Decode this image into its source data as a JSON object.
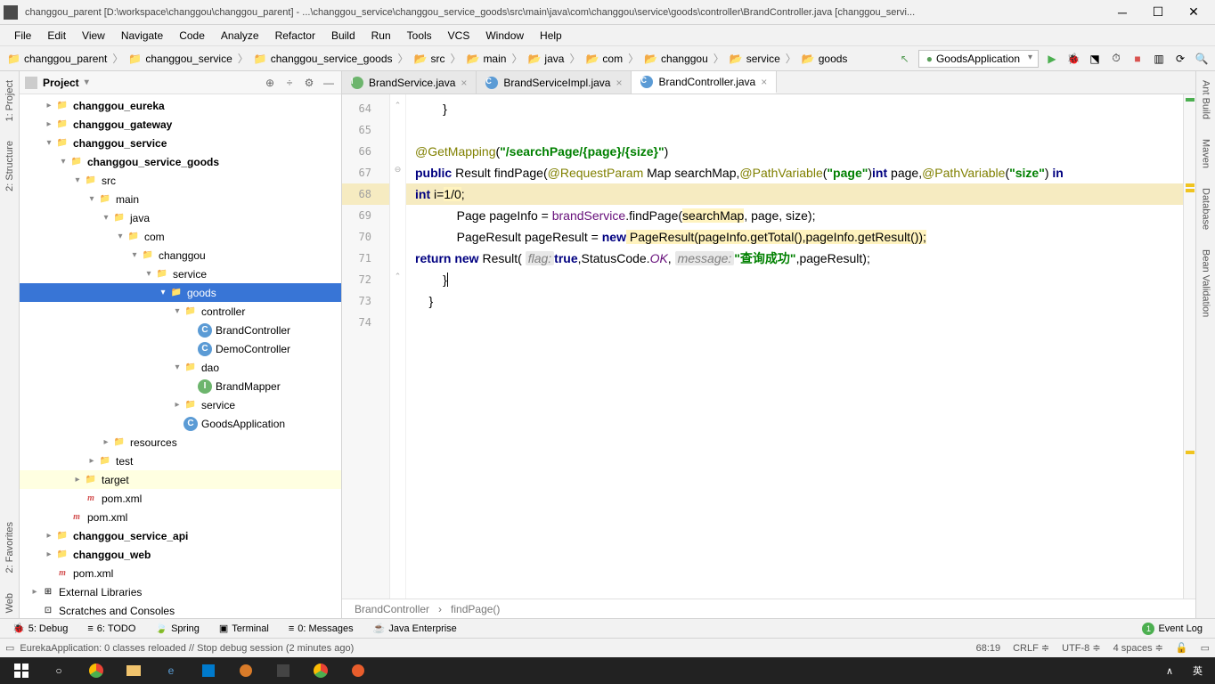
{
  "window": {
    "title": "changgou_parent [D:\\workspace\\changgou\\changgou_parent] - ...\\changgou_service\\changgou_service_goods\\src\\main\\java\\com\\changgou\\service\\goods\\controller\\BrandController.java [changgou_servi..."
  },
  "menubar": [
    "File",
    "Edit",
    "View",
    "Navigate",
    "Code",
    "Analyze",
    "Refactor",
    "Build",
    "Run",
    "Tools",
    "VCS",
    "Window",
    "Help"
  ],
  "breadcrumbs": [
    "changgou_parent",
    "changgou_service",
    "changgou_service_goods",
    "src",
    "main",
    "java",
    "com",
    "changgou",
    "service",
    "goods"
  ],
  "run_config": "GoodsApplication",
  "project_panel": {
    "title": "Project"
  },
  "tree": [
    {
      "d": 1,
      "a": "right",
      "icon": "folder",
      "label": "changgou_eureka",
      "bold": true
    },
    {
      "d": 1,
      "a": "right",
      "icon": "folder",
      "label": "changgou_gateway",
      "bold": true
    },
    {
      "d": 1,
      "a": "down",
      "icon": "folder",
      "label": "changgou_service",
      "bold": true
    },
    {
      "d": 2,
      "a": "down",
      "icon": "folder",
      "label": "changgou_service_goods",
      "bold": true
    },
    {
      "d": 3,
      "a": "down",
      "icon": "folder-blue",
      "label": "src"
    },
    {
      "d": 4,
      "a": "down",
      "icon": "folder-blue",
      "label": "main"
    },
    {
      "d": 5,
      "a": "down",
      "icon": "folder-blue",
      "label": "java"
    },
    {
      "d": 6,
      "a": "down",
      "icon": "folder",
      "label": "com"
    },
    {
      "d": 7,
      "a": "down",
      "icon": "folder",
      "label": "changgou"
    },
    {
      "d": 8,
      "a": "down",
      "icon": "folder",
      "label": "service"
    },
    {
      "d": 9,
      "a": "down",
      "icon": "folder",
      "label": "goods",
      "selected": true
    },
    {
      "d": 10,
      "a": "down",
      "icon": "folder",
      "label": "controller"
    },
    {
      "d": 11,
      "a": "",
      "icon": "class",
      "label": "BrandController"
    },
    {
      "d": 11,
      "a": "",
      "icon": "class",
      "label": "DemoController"
    },
    {
      "d": 10,
      "a": "down",
      "icon": "folder",
      "label": "dao"
    },
    {
      "d": 11,
      "a": "",
      "icon": "interface",
      "label": "BrandMapper"
    },
    {
      "d": 10,
      "a": "right",
      "icon": "folder",
      "label": "service"
    },
    {
      "d": 10,
      "a": "",
      "icon": "class",
      "label": "GoodsApplication"
    },
    {
      "d": 5,
      "a": "right",
      "icon": "folder",
      "label": "resources"
    },
    {
      "d": 4,
      "a": "right",
      "icon": "folder",
      "label": "test"
    },
    {
      "d": 3,
      "a": "right",
      "icon": "folder-orange",
      "label": "target",
      "hl": true
    },
    {
      "d": 3,
      "a": "",
      "icon": "maven",
      "label": "pom.xml"
    },
    {
      "d": 2,
      "a": "",
      "icon": "maven",
      "label": "pom.xml"
    },
    {
      "d": 1,
      "a": "right",
      "icon": "folder",
      "label": "changgou_service_api",
      "bold": true
    },
    {
      "d": 1,
      "a": "right",
      "icon": "folder",
      "label": "changgou_web",
      "bold": true
    },
    {
      "d": 1,
      "a": "",
      "icon": "maven",
      "label": "pom.xml"
    },
    {
      "d": 0,
      "a": "right",
      "icon": "lib",
      "label": "External Libraries"
    },
    {
      "d": 0,
      "a": "",
      "icon": "scratch",
      "label": "Scratches and Consoles"
    }
  ],
  "editor_tabs": [
    {
      "label": "BrandService.java",
      "icon": "interface",
      "active": false
    },
    {
      "label": "BrandServiceImpl.java",
      "icon": "class",
      "active": false
    },
    {
      "label": "BrandController.java",
      "icon": "class",
      "active": true
    }
  ],
  "line_numbers": [
    "64",
    "65",
    "66",
    "67",
    "68",
    "69",
    "70",
    "71",
    "72",
    "73",
    "74"
  ],
  "code_tokens": {
    "l64": "        }",
    "l66_ann": "@GetMapping",
    "l66_path": "\"/searchPage/{page}/{size}\"",
    "l67_public": "public",
    "l67_result": " Result findPage(",
    "l67_rp": "@RequestParam",
    "l67_map": " Map searchMap,",
    "l67_pv1": "@PathVariable",
    "l67_page_str": "\"page\"",
    "l67_int1": "int",
    "l67_page": " page,",
    "l67_pv2": "@PathVariable",
    "l67_size_str": "\"size\"",
    "l67_int_suffix": " in",
    "l68_int": "int",
    "l68_expr_i": " i=",
    "l68_expr_10": "1/0",
    "l68_semi": ";",
    "l69_page": "            Page pageInfo = ",
    "l69_brand": "brandService",
    "l69_find": ".findPage(",
    "l69_sm": "searchMap",
    "l69_rest": ", page, size);",
    "l70_pre": "            PageResult pageResult = ",
    "l70_new": "new",
    "l70_rest": " PageResult(pageInfo.getTotal(),pageInfo.getResult());",
    "l71_return": "return new",
    "l71_result": " Result( ",
    "l71_flag": "flag:",
    "l71_true": "true",
    "l71_statcode": ",StatusCode.",
    "l71_ok": "OK",
    "l71_msg": "message:",
    "l71_msgval": "\"查询成功\"",
    "l71_end": ",pageResult);",
    "l72": "        }",
    "l73": "    }"
  },
  "editor_crumb": {
    "class": "BrandController",
    "method": "findPage()"
  },
  "bottom_tabs": [
    "5: Debug",
    "6: TODO",
    "Spring",
    "Terminal",
    "0: Messages",
    "Java Enterprise"
  ],
  "event_log": "Event Log",
  "status": {
    "message": "EurekaApplication: 0 classes reloaded // Stop debug session (2 minutes ago)",
    "position": "68:19",
    "le": "CRLF",
    "encoding": "UTF-8",
    "indent": "4 spaces"
  },
  "left_tabs": [
    "1: Project",
    "2: Structure",
    "2: Favorites",
    "Web"
  ],
  "right_tabs": [
    "Ant Build",
    "Maven",
    "Database",
    "Bean Validation"
  ],
  "taskbar_tray": "英"
}
